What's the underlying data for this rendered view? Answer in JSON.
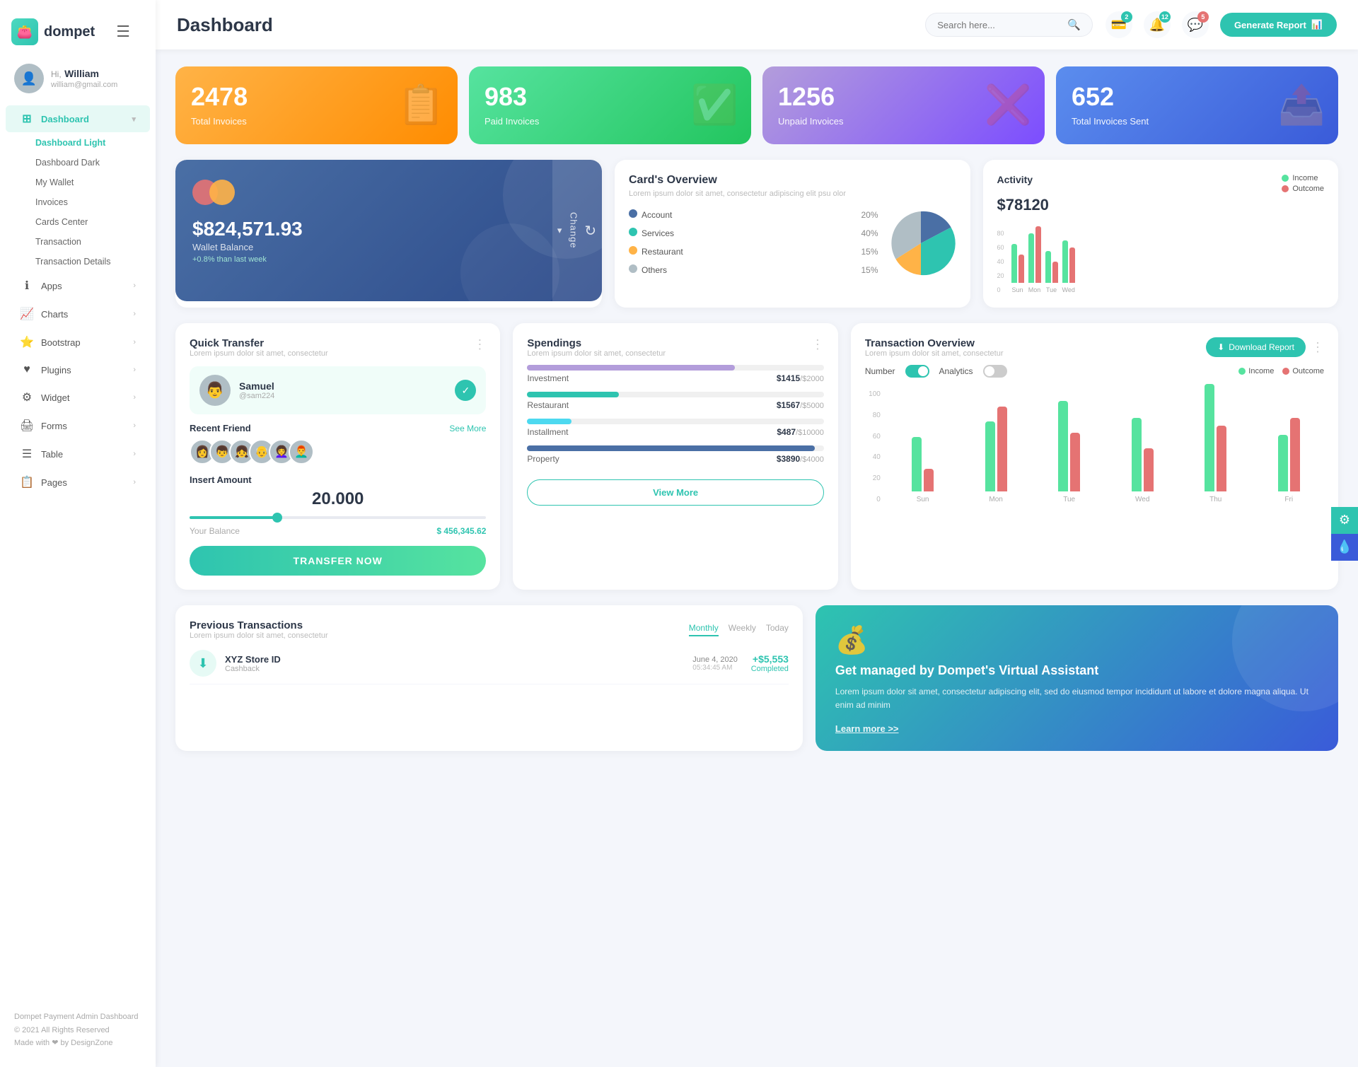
{
  "app": {
    "name": "dompet",
    "logo_emoji": "👛"
  },
  "header": {
    "title": "Dashboard",
    "search_placeholder": "Search here...",
    "generate_btn": "Generate Report",
    "badges": {
      "wallet": "2",
      "bell": "12",
      "chat": "5"
    }
  },
  "sidebar": {
    "user": {
      "greeting": "Hi,",
      "name": "William",
      "email": "william@gmail.com"
    },
    "nav": [
      {
        "id": "dashboard",
        "label": "Dashboard",
        "icon": "⊞",
        "active": true,
        "has_arrow": true
      },
      {
        "id": "apps",
        "label": "Apps",
        "icon": "ℹ",
        "has_arrow": true
      },
      {
        "id": "charts",
        "label": "Charts",
        "icon": "📈",
        "has_arrow": true
      },
      {
        "id": "bootstrap",
        "label": "Bootstrap",
        "icon": "⭐",
        "has_arrow": true
      },
      {
        "id": "plugins",
        "label": "Plugins",
        "icon": "♥",
        "has_arrow": true
      },
      {
        "id": "widget",
        "label": "Widget",
        "icon": "⚙",
        "has_arrow": true
      },
      {
        "id": "forms",
        "label": "Forms",
        "icon": "🖨",
        "has_arrow": true
      },
      {
        "id": "table",
        "label": "Table",
        "icon": "☰",
        "has_arrow": true
      },
      {
        "id": "pages",
        "label": "Pages",
        "icon": "📋",
        "has_arrow": true
      }
    ],
    "sub_items": [
      "Dashboard Light",
      "Dashboard Dark",
      "My Wallet",
      "Invoices",
      "Cards Center",
      "Transaction",
      "Transaction Details"
    ],
    "footer": {
      "brand": "Dompet Payment Admin Dashboard",
      "copyright": "© 2021 All Rights Reserved",
      "made_with": "Made with ❤ by DesignZone"
    }
  },
  "stats": [
    {
      "id": "total-invoices",
      "num": "2478",
      "label": "Total Invoices",
      "color": "orange",
      "icon": "📋"
    },
    {
      "id": "paid-invoices",
      "num": "983",
      "label": "Paid Invoices",
      "color": "green",
      "icon": "✅"
    },
    {
      "id": "unpaid-invoices",
      "num": "1256",
      "label": "Unpaid Invoices",
      "color": "purple",
      "icon": "❌"
    },
    {
      "id": "total-sent",
      "num": "652",
      "label": "Total Invoices Sent",
      "color": "blue",
      "icon": "📤"
    }
  ],
  "wallet": {
    "amount": "$824,571.93",
    "label": "Wallet Balance",
    "change": "+0.8% than last week",
    "btn": "Change"
  },
  "cards_overview": {
    "title": "Card's Overview",
    "sub": "Lorem ipsum dolor sit amet, consectetur adipiscing elit psu olor",
    "items": [
      {
        "label": "Account",
        "pct": "20%",
        "color": "#4a6fa5"
      },
      {
        "label": "Services",
        "pct": "40%",
        "color": "#2ec4b0"
      },
      {
        "label": "Restaurant",
        "pct": "15%",
        "color": "#ffb347"
      },
      {
        "label": "Others",
        "pct": "15%",
        "color": "#b0bec5"
      }
    ]
  },
  "activity": {
    "title": "Activity",
    "amount": "$78120",
    "legend": [
      {
        "label": "Income",
        "color": "#56e39f"
      },
      {
        "label": "Outcome",
        "color": "#e57373"
      }
    ],
    "bars": [
      {
        "day": "Sun",
        "income": 55,
        "outcome": 40
      },
      {
        "day": "Mon",
        "income": 70,
        "outcome": 80
      },
      {
        "day": "Tue",
        "income": 45,
        "outcome": 30
      },
      {
        "day": "Wed",
        "income": 60,
        "outcome": 50
      }
    ],
    "y_axis": [
      "80",
      "60",
      "40",
      "20",
      "0"
    ]
  },
  "quick_transfer": {
    "title": "Quick Transfer",
    "sub": "Lorem ipsum dolor sit amet, consectetur",
    "user": {
      "name": "Samuel",
      "handle": "@sam224",
      "avatar": "👨"
    },
    "recent_label": "Recent Friend",
    "see_all": "See More",
    "insert_label": "Insert Amount",
    "amount": "20.000",
    "balance_label": "Your Balance",
    "balance": "$ 456,345.62",
    "transfer_btn": "TRANSFER NOW"
  },
  "spendings": {
    "title": "Spendings",
    "sub": "Lorem ipsum dolor sit amet, consectetur",
    "items": [
      {
        "label": "Investment",
        "amount": "$1415",
        "total": "/$2000",
        "pct": 70,
        "color": "#b39ddb"
      },
      {
        "label": "Restaurant",
        "amount": "$1567",
        "total": "/$5000",
        "pct": 31,
        "color": "#2ec4b0"
      },
      {
        "label": "Installment",
        "amount": "$487",
        "total": "/$10000",
        "pct": 15,
        "color": "#4dd9f0"
      },
      {
        "label": "Property",
        "amount": "$3890",
        "total": "/$4000",
        "pct": 97,
        "color": "#4a6fa5"
      }
    ],
    "view_more_btn": "View More"
  },
  "transaction_overview": {
    "title": "Transaction Overview",
    "sub": "Lorem ipsum dolor sit amet, consectetur",
    "download_btn": "Download Report",
    "toggles": [
      {
        "label": "Number",
        "state": "on"
      },
      {
        "label": "Analytics",
        "state": "off"
      }
    ],
    "legend": [
      {
        "label": "Income",
        "color": "#56e39f"
      },
      {
        "label": "Outcome",
        "color": "#e57373"
      }
    ],
    "bars": [
      {
        "day": "Sun",
        "income": 48,
        "outcome": 20
      },
      {
        "day": "Mon",
        "income": 62,
        "outcome": 75
      },
      {
        "day": "Tue",
        "income": 80,
        "outcome": 52
      },
      {
        "day": "Wed",
        "income": 65,
        "outcome": 38
      },
      {
        "day": "Thu",
        "income": 95,
        "outcome": 58
      },
      {
        "day": "Fri",
        "income": 50,
        "outcome": 65
      }
    ],
    "y_axis": [
      "100",
      "80",
      "60",
      "40",
      "20",
      "0"
    ]
  },
  "previous_transactions": {
    "title": "Previous Transactions",
    "sub": "Lorem ipsum dolor sit amet, consectetur",
    "tabs": [
      "Monthly",
      "Weekly",
      "Today"
    ],
    "active_tab": "Monthly",
    "items": [
      {
        "name": "XYZ Store ID",
        "type": "Cashback",
        "date": "June 4, 2020",
        "time": "05:34:45 AM",
        "amount": "+$5,553",
        "status": "Completed",
        "icon": "⬇",
        "icon_color": "green"
      }
    ]
  },
  "virtual_assistant": {
    "title": "Get managed by Dompet's Virtual Assistant",
    "sub": "Lorem ipsum dolor sit amet, consectetur adipiscing elit, sed do eiusmod tempor incididunt ut labore et dolore magna aliqua. Ut enim ad minim",
    "learn_more": "Learn more >>",
    "icon": "💰"
  },
  "floating": {
    "settings_icon": "⚙",
    "drop_icon": "💧"
  }
}
